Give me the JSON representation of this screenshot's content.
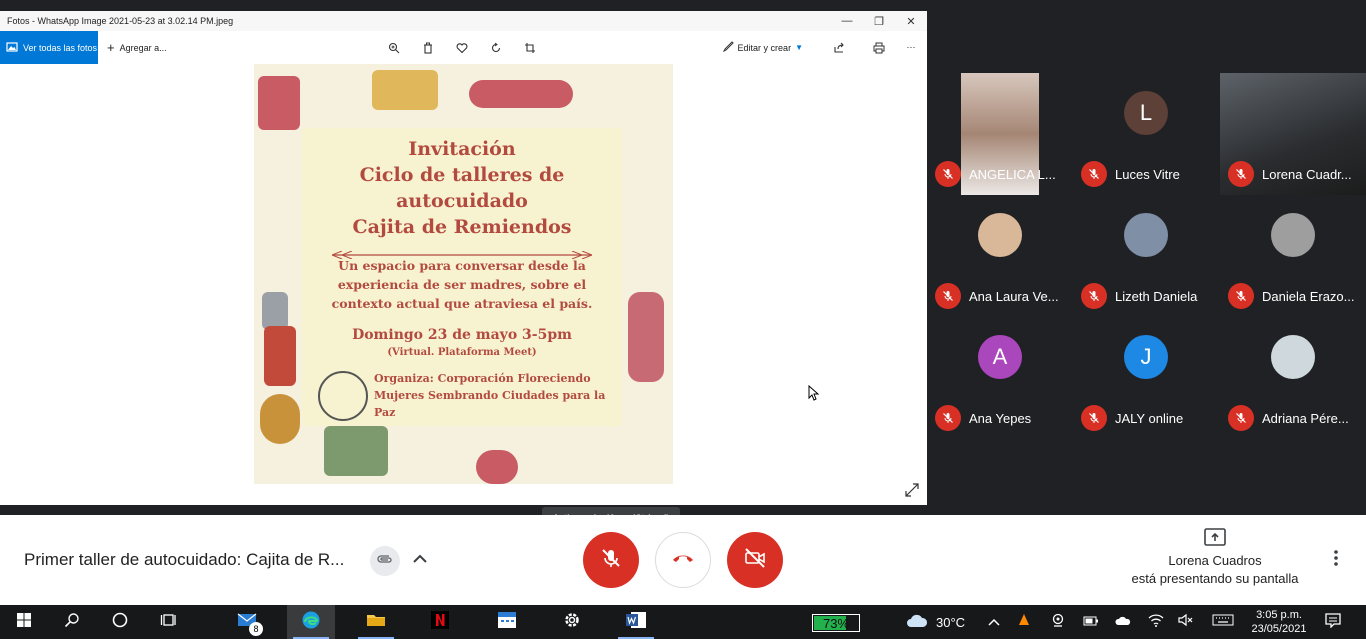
{
  "photos": {
    "title": "Fotos - WhatsApp Image 2021-05-23 at 3.02.14 PM.jpeg",
    "toolbar": {
      "view_all_label": "Ver todas las fotos",
      "add_label": "Agregar a...",
      "edit_label": "Editar y crear"
    }
  },
  "invitation": {
    "heading": [
      "Invitación",
      "Ciclo de talleres de",
      "autocuidado",
      "Cajita de Remiendos"
    ],
    "subtitle": [
      "Un espacio para conversar desde la",
      "experiencia de ser madres, sobre el",
      "contexto actual que atraviesa el país."
    ],
    "date": "Domingo 23 de mayo 3-5pm",
    "virtual": "(Virtual. Plataforma Meet)",
    "organizer": [
      "Organiza: Corporación Floreciendo",
      "Mujeres Sembrando Ciudades para la Paz"
    ]
  },
  "tooltip": "Activar micrófono (Ctrl + d)",
  "participants": [
    {
      "name": "ANGELICA L...",
      "type": "photo"
    },
    {
      "name": "Luces Vitre",
      "type": "letter",
      "initial": "L",
      "color": "#5d4037"
    },
    {
      "name": "Lorena Cuadr...",
      "type": "photo-wide"
    },
    {
      "name": "Ana Laura Ve...",
      "type": "avatar-img",
      "color": "#d9b89a"
    },
    {
      "name": "Lizeth Daniela",
      "type": "avatar-img",
      "color": "#7f8fa6"
    },
    {
      "name": "Daniela Erazo...",
      "type": "avatar-img",
      "color": "#9e9e9e"
    },
    {
      "name": "Ana Yepes",
      "type": "letter",
      "initial": "A",
      "color": "#ab47bc"
    },
    {
      "name": "JALY online",
      "type": "letter",
      "initial": "J",
      "color": "#1e88e5"
    },
    {
      "name": "Adriana Pére...",
      "type": "avatar-img",
      "color": "#cfd8dc"
    }
  ],
  "meetbar": {
    "meeting_title": "Primer taller de autocuidado: Cajita de R...",
    "presenter_name": "Lorena Cuadros",
    "presenting_text": "está presentando su pantalla",
    "colors": {
      "red": "#ea4335",
      "white": "#ffffff"
    }
  },
  "taskbar": {
    "mail_badge": "8",
    "battery": "73%",
    "battery_level": 0.73,
    "temperature": "30°C",
    "time": "3:05 p.m.",
    "date": "23/05/2021"
  }
}
